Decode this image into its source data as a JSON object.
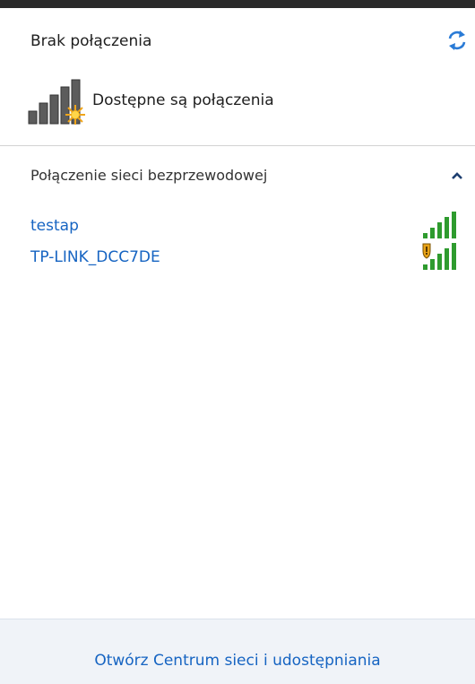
{
  "status": {
    "title": "Brak połączenia",
    "subtitle": "Dostępne są połączenia"
  },
  "section": {
    "header": "Połączenie sieci bezprzewodowej"
  },
  "networks": [
    {
      "name": "testap",
      "secured": false
    },
    {
      "name": "TP-LINK_DCC7DE",
      "secured": true
    }
  ],
  "footer": {
    "link": "Otwórz Centrum sieci i udostępniania"
  },
  "colors": {
    "link": "#1664c2",
    "signal_green": "#2e9b2e",
    "shield": "#e8a317"
  },
  "icons": {
    "refresh": "refresh-icon",
    "collapse": "chevron-up-icon",
    "big_signal": "wifi-available-icon",
    "signal": "signal-strength-icon",
    "security": "security-shield-icon"
  }
}
